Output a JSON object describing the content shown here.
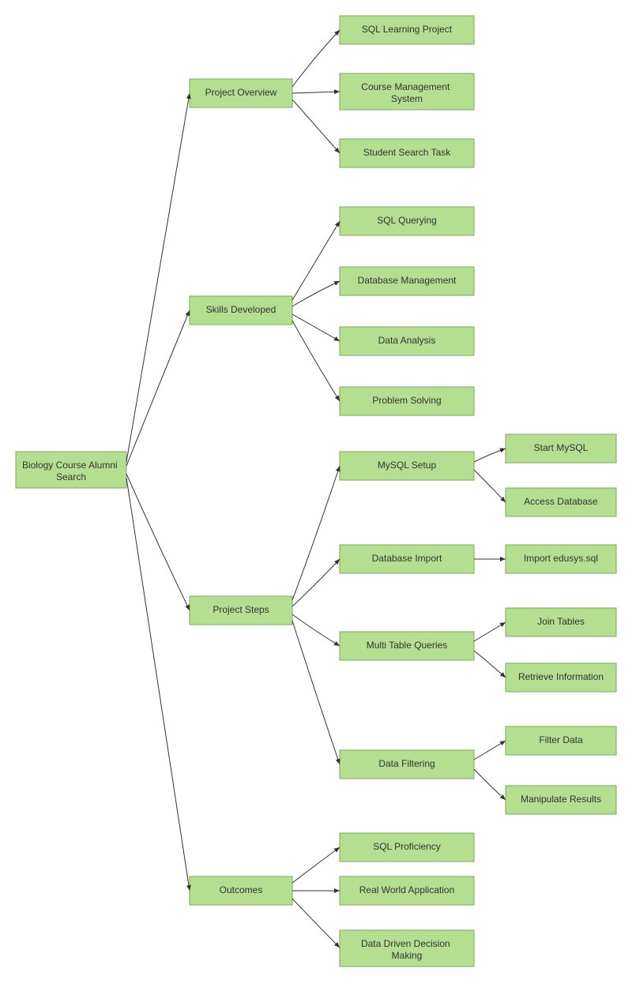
{
  "nodes": {
    "root": "Biology Course Alumni Search",
    "l1": {
      "overview": "Project Overview",
      "skills": "Skills Developed",
      "steps": "Project Steps",
      "outcomes": "Outcomes"
    },
    "overview_children": {
      "c1": "SQL Learning Project",
      "c2": "Course Management System",
      "c3": "Student Search Task"
    },
    "skills_children": {
      "c1": "SQL Querying",
      "c2": "Database Management",
      "c3": "Data Analysis",
      "c4": "Problem Solving"
    },
    "steps_children": {
      "c1": "MySQL Setup",
      "c2": "Database Import",
      "c3": "Multi Table Queries",
      "c4": "Data Filtering"
    },
    "mysql_children": {
      "c1": "Start MySQL",
      "c2": "Access Database"
    },
    "dbimport_children": {
      "c1": "Import edusys.sql"
    },
    "multitable_children": {
      "c1": "Join Tables",
      "c2": "Retrieve Information"
    },
    "filtering_children": {
      "c1": "Filter Data",
      "c2": "Manipulate Results"
    },
    "outcomes_children": {
      "c1": "SQL Proficiency",
      "c2": "Real World Application",
      "c3": "Data Driven Decision Making"
    }
  }
}
